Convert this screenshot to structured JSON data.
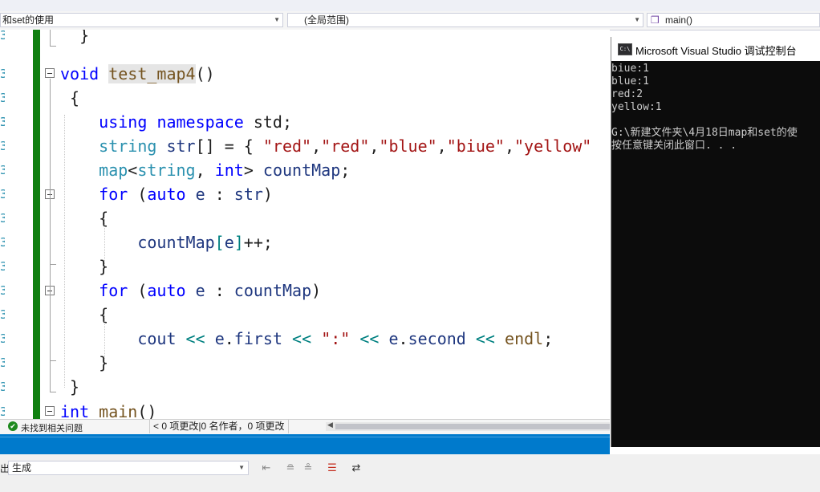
{
  "navbar": {
    "file_scope": "和set的使用",
    "global_scope": "(全局范围)",
    "member": "main()"
  },
  "editor": {
    "lines": [
      {
        "segments": [
          {
            "t": "  }",
            "c": ""
          }
        ]
      },
      {
        "segments": [
          {
            "t": "void",
            "c": "kw"
          },
          {
            "t": " ",
            "c": ""
          },
          {
            "t": "test_map4",
            "c": "fn hl"
          },
          {
            "t": "()",
            "c": ""
          }
        ]
      },
      {
        "segments": [
          {
            "t": " {",
            "c": ""
          }
        ]
      },
      {
        "segments": [
          {
            "t": "",
            "c": ""
          }
        ]
      },
      {
        "segments": [
          {
            "t": "    ",
            "c": ""
          },
          {
            "t": "using",
            "c": "kw"
          },
          {
            "t": " ",
            "c": ""
          },
          {
            "t": "namespace",
            "c": "kw"
          },
          {
            "t": " std;",
            "c": ""
          }
        ]
      },
      {
        "segments": [
          {
            "t": "    ",
            "c": ""
          },
          {
            "t": "string",
            "c": "ty"
          },
          {
            "t": " ",
            "c": ""
          },
          {
            "t": "str",
            "c": "var"
          },
          {
            "t": "[] = { ",
            "c": ""
          },
          {
            "t": "\"red\"",
            "c": "str"
          },
          {
            "t": ",",
            "c": ""
          },
          {
            "t": "\"red\"",
            "c": "str"
          },
          {
            "t": ",",
            "c": ""
          },
          {
            "t": "\"blue\"",
            "c": "str"
          },
          {
            "t": ",",
            "c": ""
          },
          {
            "t": "\"biue\"",
            "c": "str"
          },
          {
            "t": ",",
            "c": ""
          },
          {
            "t": "\"yellow\"",
            "c": "str"
          }
        ]
      },
      {
        "segments": [
          {
            "t": "    ",
            "c": ""
          },
          {
            "t": "map",
            "c": "ty"
          },
          {
            "t": "<",
            "c": ""
          },
          {
            "t": "string",
            "c": "ty"
          },
          {
            "t": ", ",
            "c": ""
          },
          {
            "t": "int",
            "c": "kw"
          },
          {
            "t": "> ",
            "c": ""
          },
          {
            "t": "countMap",
            "c": "var"
          },
          {
            "t": ";",
            "c": ""
          }
        ]
      },
      {
        "segments": [
          {
            "t": "    ",
            "c": ""
          },
          {
            "t": "for",
            "c": "kw"
          },
          {
            "t": " (",
            "c": ""
          },
          {
            "t": "auto",
            "c": "kw"
          },
          {
            "t": " ",
            "c": ""
          },
          {
            "t": "e",
            "c": "var"
          },
          {
            "t": " : ",
            "c": ""
          },
          {
            "t": "str",
            "c": "var"
          },
          {
            "t": ")",
            "c": ""
          }
        ]
      },
      {
        "segments": [
          {
            "t": "    {",
            "c": ""
          }
        ]
      },
      {
        "segments": [
          {
            "t": "        ",
            "c": ""
          },
          {
            "t": "countMap",
            "c": "var"
          },
          {
            "t": "[",
            "c": "op"
          },
          {
            "t": "e",
            "c": "var"
          },
          {
            "t": "]",
            "c": "op"
          },
          {
            "t": "++;",
            "c": ""
          }
        ]
      },
      {
        "segments": [
          {
            "t": "    }",
            "c": ""
          }
        ]
      },
      {
        "segments": [
          {
            "t": "    ",
            "c": ""
          },
          {
            "t": "for",
            "c": "kw"
          },
          {
            "t": " (",
            "c": ""
          },
          {
            "t": "auto",
            "c": "kw"
          },
          {
            "t": " ",
            "c": ""
          },
          {
            "t": "e",
            "c": "var"
          },
          {
            "t": " : ",
            "c": ""
          },
          {
            "t": "countMap",
            "c": "var"
          },
          {
            "t": ")",
            "c": ""
          }
        ]
      },
      {
        "segments": [
          {
            "t": "    {",
            "c": ""
          }
        ]
      },
      {
        "segments": [
          {
            "t": "        ",
            "c": ""
          },
          {
            "t": "cout",
            "c": "var"
          },
          {
            "t": " ",
            "c": ""
          },
          {
            "t": "<<",
            "c": "op"
          },
          {
            "t": " ",
            "c": ""
          },
          {
            "t": "e",
            "c": "var"
          },
          {
            "t": ".",
            "c": ""
          },
          {
            "t": "first",
            "c": "var"
          },
          {
            "t": " ",
            "c": ""
          },
          {
            "t": "<<",
            "c": "op"
          },
          {
            "t": " ",
            "c": ""
          },
          {
            "t": "\":\"",
            "c": "str"
          },
          {
            "t": " ",
            "c": ""
          },
          {
            "t": "<<",
            "c": "op"
          },
          {
            "t": " ",
            "c": ""
          },
          {
            "t": "e",
            "c": "var"
          },
          {
            "t": ".",
            "c": ""
          },
          {
            "t": "second",
            "c": "var"
          },
          {
            "t": " ",
            "c": ""
          },
          {
            "t": "<<",
            "c": "op"
          },
          {
            "t": " ",
            "c": ""
          },
          {
            "t": "endl",
            "c": "fn"
          },
          {
            "t": ";",
            "c": ""
          }
        ]
      },
      {
        "segments": [
          {
            "t": "    }",
            "c": ""
          }
        ]
      },
      {
        "segments": [
          {
            "t": " }",
            "c": ""
          }
        ]
      },
      {
        "segments": [
          {
            "t": "int",
            "c": "kw"
          },
          {
            "t": " ",
            "c": ""
          },
          {
            "t": "main",
            "c": "fn"
          },
          {
            "t": "()",
            "c": ""
          }
        ]
      }
    ]
  },
  "status": {
    "issues": "未找到相关问题",
    "changes": "0 项更改|0 名作者，0 项更改"
  },
  "output": {
    "label": "出",
    "source": "生成"
  },
  "console": {
    "title": "Microsoft Visual Studio 调试控制台",
    "icon_text": "C:\\",
    "lines": [
      "biue:1",
      "blue:1",
      "red:2",
      "yellow:1",
      "",
      "G:\\新建文件夹\\4月18日map和set的使",
      "按任意键关闭此窗口. . ."
    ]
  },
  "colors": {
    "keyword": "#0000ff",
    "type": "#2b91af",
    "string": "#a31515",
    "accent": "#007acc",
    "margin_green": "#108010"
  }
}
